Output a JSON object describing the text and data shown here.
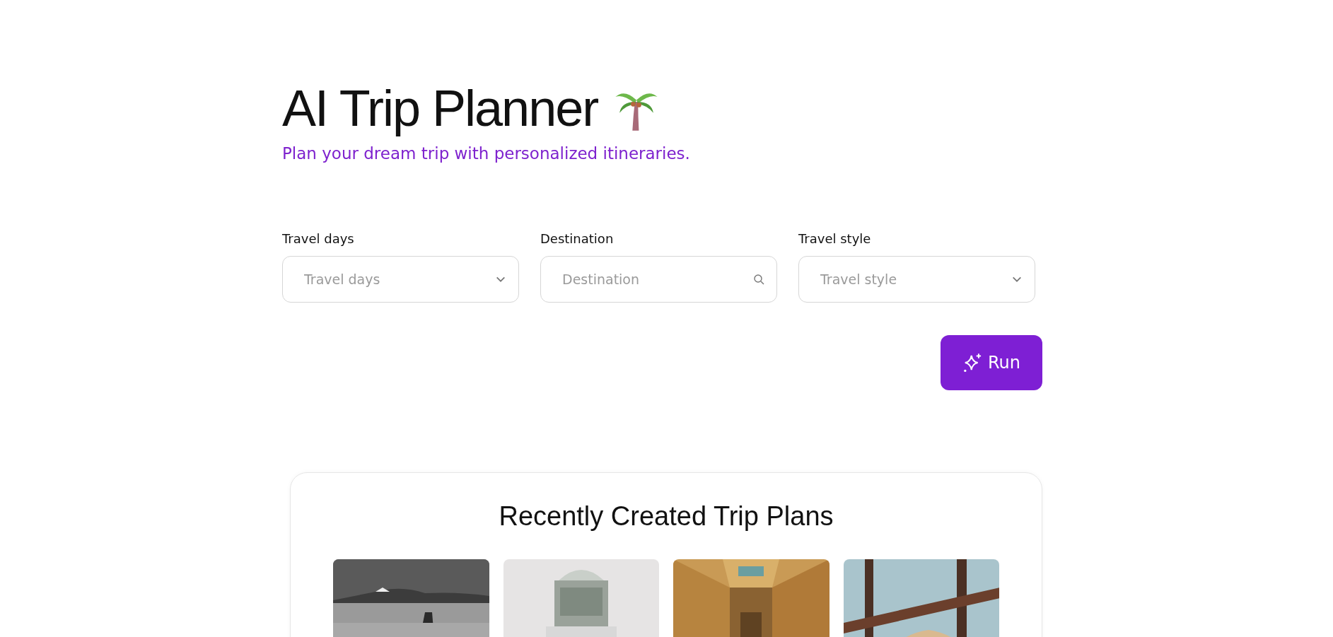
{
  "header": {
    "title": "AI Trip Planner",
    "subtitle": "Plan your dream trip with personalized itineraries."
  },
  "fields": [
    {
      "kind": "select",
      "label": "Travel days",
      "placeholder": "Travel days"
    },
    {
      "kind": "search",
      "label": "Destination",
      "placeholder": "Destination"
    },
    {
      "kind": "select",
      "label": "Travel style",
      "placeholder": "Travel style"
    }
  ],
  "run_button": {
    "label": "Run"
  },
  "recent": {
    "title": "Recently Created Trip Plans"
  }
}
